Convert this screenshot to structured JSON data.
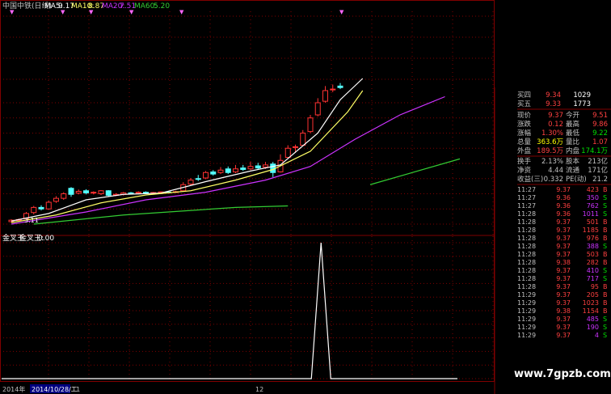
{
  "header": {
    "title": "中国中铁(日线)",
    "ma5_label": "MA5:",
    "ma5_value": "9.17",
    "ma10_label": "MA10:",
    "ma10_value": "8.87",
    "ma20_label": "MA20:",
    "ma20_value": "7.51",
    "ma60_label": "MA60:",
    "ma60_value": "5.20"
  },
  "indicator": {
    "title": "金叉王",
    "label": "金叉王:",
    "value": "0.00"
  },
  "bottom": {
    "period_label": "2014年",
    "date_label": "2014/10/28/二",
    "date_suffix": "11",
    "mid_label": "12"
  },
  "watermark": "www.7gpzb.com",
  "low_marker": "3.11",
  "quote": {
    "rows": [
      {
        "label": "买四",
        "v1": "9.34",
        "v2": "1029",
        "c1": "#ff4040",
        "c2": "#ffffff"
      },
      {
        "label": "买五",
        "v1": "9.33",
        "v2": "1773",
        "c1": "#ff4040",
        "c2": "#ffffff"
      }
    ],
    "stats": [
      {
        "l1": "现价",
        "v1": "9.37",
        "c1": "#ff4040",
        "l2": "今开",
        "v2": "9.51",
        "c2": "#ff4040"
      },
      {
        "l1": "涨跌",
        "v1": "0.12",
        "c1": "#ff4040",
        "l2": "最高",
        "v2": "9.86",
        "c2": "#ff4040"
      },
      {
        "l1": "涨幅",
        "v1": "1.30%",
        "c1": "#ff4040",
        "l2": "最低",
        "v2": "9.22",
        "c2": "#00e000"
      },
      {
        "l1": "总量",
        "v1": "363.6万",
        "c1": "#ffff00",
        "l2": "量比",
        "v2": "1.07",
        "c2": "#ff4040"
      },
      {
        "l1": "外盘",
        "v1": "189.5万",
        "c1": "#ff4040",
        "l2": "内盘",
        "v2": "174.1万",
        "c2": "#00e000"
      },
      {
        "l1": "换手",
        "v1": "2.13%",
        "c1": "#c0c0c0",
        "l2": "股本",
        "v2": "213亿",
        "c2": "#c0c0c0"
      },
      {
        "l1": "净资",
        "v1": "4.44",
        "c1": "#c0c0c0",
        "l2": "流通",
        "v2": "171亿",
        "c2": "#c0c0c0"
      },
      {
        "l1": "收益(三)",
        "v1": "0.332",
        "c1": "#c0c0c0",
        "l2": "PE(动)",
        "v2": "21.2",
        "c2": "#c0c0c0"
      }
    ],
    "trades": [
      {
        "t": "11:27",
        "p": "9.37",
        "v": "423",
        "s": "B"
      },
      {
        "t": "11:27",
        "p": "9.36",
        "v": "350",
        "s": "S"
      },
      {
        "t": "11:27",
        "p": "9.36",
        "v": "762",
        "s": "S"
      },
      {
        "t": "11:28",
        "p": "9.36",
        "v": "1011",
        "s": "S"
      },
      {
        "t": "11:28",
        "p": "9.37",
        "v": "501",
        "s": "B"
      },
      {
        "t": "11:28",
        "p": "9.37",
        "v": "1185",
        "s": "B"
      },
      {
        "t": "11:28",
        "p": "9.37",
        "v": "976",
        "s": "B"
      },
      {
        "t": "11:28",
        "p": "9.37",
        "v": "388",
        "s": "S"
      },
      {
        "t": "11:28",
        "p": "9.37",
        "v": "503",
        "s": "B"
      },
      {
        "t": "11:28",
        "p": "9.38",
        "v": "282",
        "s": "B"
      },
      {
        "t": "11:28",
        "p": "9.37",
        "v": "410",
        "s": "S"
      },
      {
        "t": "11:28",
        "p": "9.37",
        "v": "717",
        "s": "S"
      },
      {
        "t": "11:28",
        "p": "9.37",
        "v": "95",
        "s": "B"
      },
      {
        "t": "11:29",
        "p": "9.37",
        "v": "205",
        "s": "B"
      },
      {
        "t": "11:29",
        "p": "9.37",
        "v": "1023",
        "s": "B"
      },
      {
        "t": "11:29",
        "p": "9.38",
        "v": "1154",
        "s": "B"
      },
      {
        "t": "11:29",
        "p": "9.37",
        "v": "485",
        "s": "S"
      },
      {
        "t": "11:29",
        "p": "9.37",
        "v": "190",
        "s": "S"
      },
      {
        "t": "11:29",
        "p": "9.37",
        "v": "4",
        "s": "S"
      }
    ]
  },
  "colors": {
    "up": "#ff3232",
    "down": "#54ffff",
    "grid": "#800000",
    "ma5": "#ffffff",
    "ma10": "#ffff66",
    "ma20": "#cc33ff",
    "ma60": "#33cc33",
    "signal": "#ffffff"
  },
  "chart_data": [
    {
      "type": "candlestick",
      "title": "中国中铁(日线)",
      "y_axis_ticks": [
        "7.00",
        "6.50",
        "6.00",
        "5.50",
        "5.00",
        "4.50",
        "4.00",
        "3.50",
        "3.00"
      ],
      "ylim": [
        2.85,
        7.7
      ],
      "candles": [
        {
          "o": 3.08,
          "c": 3.13,
          "h": 3.16,
          "l": 3.05
        },
        {
          "o": 3.12,
          "c": 3.15,
          "h": 3.18,
          "l": 3.1
        },
        {
          "o": 3.18,
          "c": 3.35,
          "h": 3.4,
          "l": 3.15
        },
        {
          "o": 3.38,
          "c": 3.55,
          "h": 3.6,
          "l": 3.32
        },
        {
          "o": 3.55,
          "c": 3.5,
          "h": 3.62,
          "l": 3.45
        },
        {
          "o": 3.5,
          "c": 3.72,
          "h": 3.78,
          "l": 3.48
        },
        {
          "o": 3.75,
          "c": 3.85,
          "h": 3.92,
          "l": 3.7
        },
        {
          "o": 3.85,
          "c": 4.0,
          "h": 4.05,
          "l": 3.8
        },
        {
          "o": 4.18,
          "c": 3.98,
          "h": 4.22,
          "l": 3.9
        },
        {
          "o": 4.02,
          "c": 4.08,
          "h": 4.14,
          "l": 3.98
        },
        {
          "o": 4.1,
          "c": 4.03,
          "h": 4.15,
          "l": 3.98
        },
        {
          "o": 4.03,
          "c": 4.05,
          "h": 4.08,
          "l": 3.98
        },
        {
          "o": 4.0,
          "c": 4.1,
          "h": 4.12,
          "l": 3.96
        },
        {
          "o": 4.1,
          "c": 3.95,
          "h": 4.12,
          "l": 3.9
        },
        {
          "o": 3.95,
          "c": 3.98,
          "h": 4.02,
          "l": 3.92
        },
        {
          "o": 3.98,
          "c": 4.03,
          "h": 4.06,
          "l": 3.94
        },
        {
          "o": 4.03,
          "c": 4.01,
          "h": 4.06,
          "l": 3.98
        },
        {
          "o": 4.02,
          "c": 4.05,
          "h": 4.08,
          "l": 3.98
        },
        {
          "o": 4.05,
          "c": 4.02,
          "h": 4.08,
          "l": 4.0
        },
        {
          "o": 4.02,
          "c": 4.04,
          "h": 4.06,
          "l": 4.0
        },
        {
          "o": 4.04,
          "c": 4.06,
          "h": 4.08,
          "l": 4.02
        },
        {
          "o": 4.06,
          "c": 4.04,
          "h": 4.09,
          "l": 4.02
        },
        {
          "o": 4.05,
          "c": 4.07,
          "h": 4.1,
          "l": 4.03
        },
        {
          "o": 4.1,
          "c": 4.3,
          "h": 4.38,
          "l": 4.08
        },
        {
          "o": 4.32,
          "c": 4.45,
          "h": 4.52,
          "l": 4.28
        },
        {
          "o": 4.5,
          "c": 4.48,
          "h": 4.62,
          "l": 4.42
        },
        {
          "o": 4.52,
          "c": 4.7,
          "h": 4.75,
          "l": 4.48
        },
        {
          "o": 4.72,
          "c": 4.65,
          "h": 4.78,
          "l": 4.6
        },
        {
          "o": 4.7,
          "c": 4.78,
          "h": 4.88,
          "l": 4.65
        },
        {
          "o": 4.82,
          "c": 4.7,
          "h": 4.9,
          "l": 4.65
        },
        {
          "o": 4.72,
          "c": 4.82,
          "h": 4.95,
          "l": 4.68
        },
        {
          "o": 4.85,
          "c": 4.8,
          "h": 4.95,
          "l": 4.75
        },
        {
          "o": 4.82,
          "c": 4.9,
          "h": 5.05,
          "l": 4.78
        },
        {
          "o": 4.92,
          "c": 4.85,
          "h": 5.02,
          "l": 4.8
        },
        {
          "o": 4.88,
          "c": 4.95,
          "h": 5.05,
          "l": 4.82
        },
        {
          "o": 4.98,
          "c": 4.7,
          "h": 5.05,
          "l": 4.55
        },
        {
          "o": 4.72,
          "c": 5.1,
          "h": 5.3,
          "l": 4.7
        },
        {
          "o": 5.2,
          "c": 5.5,
          "h": 5.6,
          "l": 5.15
        },
        {
          "o": 5.55,
          "c": 5.55,
          "h": 5.62,
          "l": 5.35
        },
        {
          "o": 5.6,
          "c": 6.0,
          "h": 6.1,
          "l": 5.58
        },
        {
          "o": 6.05,
          "c": 6.5,
          "h": 6.6,
          "l": 6.0
        },
        {
          "o": 6.6,
          "c": 7.0,
          "h": 7.15,
          "l": 6.55
        },
        {
          "o": 7.05,
          "c": 7.4,
          "h": 7.55,
          "l": 7.0
        },
        {
          "o": 7.45,
          "c": 7.45,
          "h": 7.6,
          "l": 7.35
        },
        {
          "o": 7.55,
          "c": 7.5,
          "h": 7.65,
          "l": 7.45
        }
      ],
      "ma_lines": {
        "ma5": [
          [
            0,
            3.1
          ],
          [
            5,
            3.35
          ],
          [
            10,
            3.8
          ],
          [
            15,
            3.98
          ],
          [
            20,
            4.02
          ],
          [
            26,
            4.4
          ],
          [
            32,
            4.75
          ],
          [
            36,
            4.95
          ],
          [
            41,
            6.0
          ],
          [
            44,
            7.1
          ],
          [
            47,
            7.8
          ]
        ],
        "ma10": [
          [
            0,
            3.05
          ],
          [
            6,
            3.3
          ],
          [
            12,
            3.7
          ],
          [
            18,
            3.96
          ],
          [
            24,
            4.1
          ],
          [
            30,
            4.45
          ],
          [
            35,
            4.8
          ],
          [
            40,
            5.4
          ],
          [
            45,
            6.7
          ],
          [
            47,
            7.4
          ]
        ],
        "ma20": [
          [
            0,
            3.0
          ],
          [
            10,
            3.4
          ],
          [
            18,
            3.8
          ],
          [
            26,
            4.05
          ],
          [
            34,
            4.45
          ],
          [
            40,
            4.9
          ],
          [
            46,
            5.8
          ],
          [
            52,
            6.6
          ],
          [
            58,
            7.2
          ]
        ],
        "ma60": [
          [
            3,
            3.0
          ],
          [
            15,
            3.3
          ],
          [
            30,
            3.55
          ],
          [
            37,
            3.6
          ]
        ],
        "ma60b": [
          [
            48,
            4.3
          ],
          [
            60,
            5.15
          ]
        ]
      }
    },
    {
      "type": "line",
      "title": "金叉王",
      "y_axis_ticks": [
        "1.00",
        "0.90",
        "0.80",
        "0.70",
        "0.60",
        "0.50",
        "0.40",
        "0.30",
        "0.20",
        "0.10",
        "0.00"
      ],
      "ylim": [
        0,
        1
      ],
      "spike": {
        "at": 41,
        "value": 1.0
      }
    }
  ]
}
